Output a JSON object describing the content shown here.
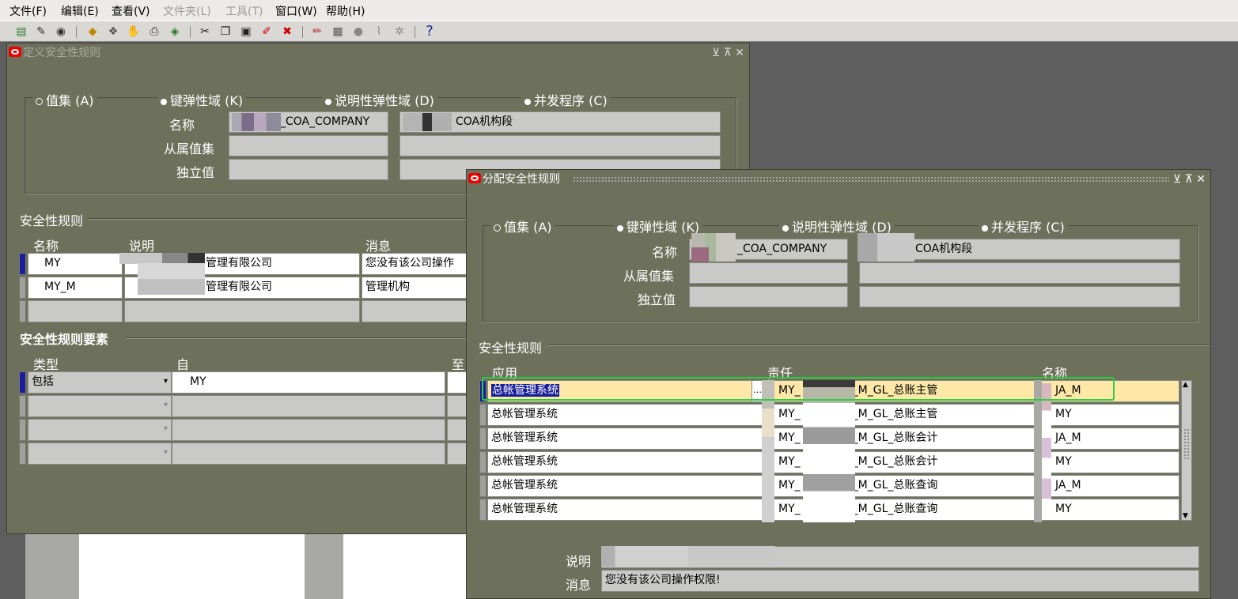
{
  "menu": [
    "文件(F)",
    "编辑(E)",
    "查看(V)",
    "文件夹(L)",
    "工具(T)",
    "窗口(W)",
    "帮助(H)"
  ],
  "back_window": {
    "title": "定义安全性规则",
    "radios": {
      "value_set": "值集 (A)",
      "key_flex": "键弹性域 (K)",
      "desc_flex": "说明性弹性域 (D)",
      "concurrent": "并发程序 (C)"
    },
    "labels": {
      "name": "名称",
      "dependent_value_set": "从属值集",
      "independent_value": "独立值"
    },
    "name_value_1": "_COA_COMPANY",
    "name_value_2": "COA机构段",
    "security_rules_section": "安全性规则",
    "rules_headers": {
      "name": "名称",
      "description": "说明",
      "message": "消息"
    },
    "rules": [
      {
        "name": "MY",
        "description": "管理有限公司",
        "message": "您没有该公司操作"
      },
      {
        "name": "MY_M",
        "description": "管理有限公司",
        "message": "管理机构"
      }
    ],
    "elements_section": "安全性规则要素",
    "elements_headers": {
      "type": "类型",
      "from": "自",
      "to": "至"
    },
    "elements": [
      {
        "type": "包括",
        "from": "MY"
      }
    ]
  },
  "front_window": {
    "title": "分配安全性规则",
    "radios": {
      "value_set": "值集 (A)",
      "key_flex": "键弹性域 (K)",
      "desc_flex": "说明性弹性域 (D)",
      "concurrent": "并发程序 (C)"
    },
    "labels": {
      "name": "名称",
      "dependent_value_set": "从属值集",
      "independent_value": "独立值"
    },
    "name_value_1": "_COA_COMPANY",
    "name_value_2": "COA机构段",
    "security_rules_section": "安全性规则",
    "headers": {
      "application": "应用",
      "responsibility": "责任",
      "name": "名称"
    },
    "rows": [
      {
        "application": "总帐管理系统",
        "resp_prefix": "MY_",
        "resp_suffix": "_M_GL_总账主管",
        "name": "JA_M"
      },
      {
        "application": "总帐管理系统",
        "resp_prefix": "MY_",
        "resp_suffix": "_M_GL_总账主管",
        "name": "MY"
      },
      {
        "application": "总帐管理系统",
        "resp_prefix": "MY_",
        "resp_suffix": "_M_GL_总账会计",
        "name": "JA_M"
      },
      {
        "application": "总帐管理系统",
        "resp_prefix": "MY_",
        "resp_suffix": "_M_GL_总账会计",
        "name": "MY"
      },
      {
        "application": "总帐管理系统",
        "resp_prefix": "MY_",
        "resp_suffix": "_M_GL_总账查询",
        "name": "JA_M"
      },
      {
        "application": "总帐管理系统",
        "resp_prefix": "MY_",
        "resp_suffix": "_M_GL_总账查询",
        "name": "MY"
      }
    ],
    "desc_label": "说明",
    "msg_label": "消息",
    "message_value": "您没有该公司操作权限!"
  },
  "colors": {
    "window_bg": "#6d715c",
    "selection": "#1a1f9a",
    "highlight_row": "#fde8a8",
    "focus_outline": "#2ecc40"
  }
}
